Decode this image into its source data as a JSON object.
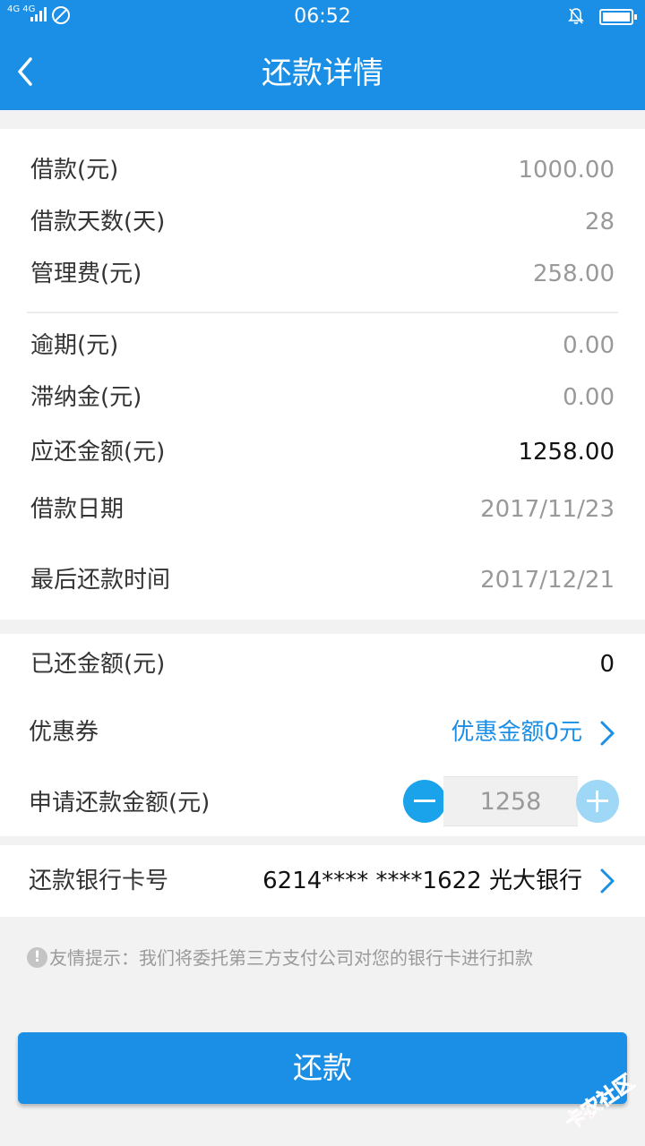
{
  "status_bar": {
    "network_label": "4G 4G",
    "time": "06:52"
  },
  "header": {
    "title": "还款详情",
    "back_icon": "back-arrow-icon"
  },
  "loan_info": {
    "rows": [
      {
        "label": "借款(元)",
        "value": "1000.00"
      },
      {
        "label": "借款天数(天)",
        "value": "28"
      },
      {
        "label": "管理费(元)",
        "value": "258.00"
      }
    ]
  },
  "repay_info": {
    "rows": [
      {
        "label": "逾期(元)",
        "value": "0.00"
      },
      {
        "label": "滞纳金(元)",
        "value": "0.00"
      },
      {
        "label": "应还金额(元)",
        "value": "1258.00"
      },
      {
        "label": "借款日期",
        "value": "2017/11/23"
      },
      {
        "label": "最后还款时间",
        "value": "2017/12/21"
      }
    ]
  },
  "payment": {
    "repaid_label": "已还金额(元)",
    "repaid_value": "0",
    "coupon_label": "优惠券",
    "coupon_value": "优惠金额0元",
    "apply_label": "申请还款金额(元)",
    "apply_amount": "1258"
  },
  "bank": {
    "label": "还款银行卡号",
    "value": "6214**** ****1622 光大银行"
  },
  "tip": {
    "icon_text": "!",
    "text": "友情提示：我们将委托第三方支付公司对您的银行卡进行扣款"
  },
  "actions": {
    "repay_label": "还款"
  },
  "watermark": {
    "text": "卡农社区"
  },
  "colors": {
    "brand": "#1a8fe5",
    "minus_button": "#1aa3ea",
    "plus_button_disabled": "#9fd8f6",
    "muted_text": "#999999",
    "background": "#f2f2f2"
  }
}
